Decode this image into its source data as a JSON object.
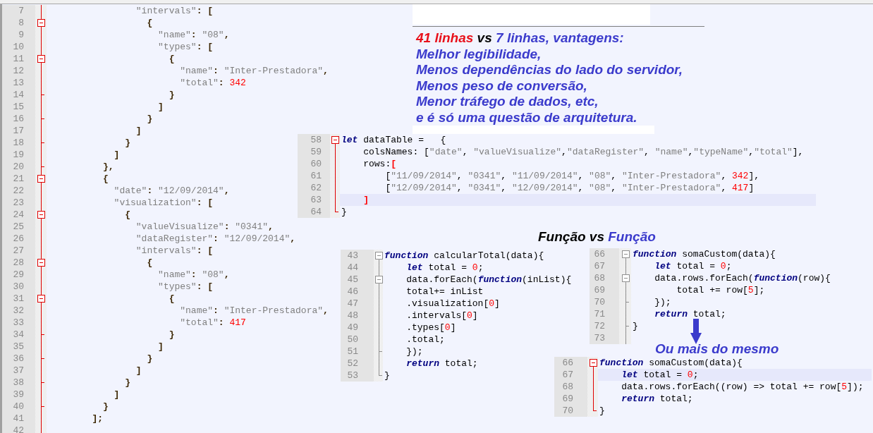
{
  "main_editor": {
    "fold_active": true,
    "lines": [
      {
        "number": "7",
        "kind": "line",
        "tokens": [
          {
            "kind": "string",
            "text": "                \"intervals\""
          },
          {
            "kind": "punct",
            "text": ": ["
          }
        ]
      },
      {
        "number": "8",
        "kind": "open",
        "tokens": [
          {
            "kind": "punct",
            "text": "                  {"
          }
        ]
      },
      {
        "number": "9",
        "kind": "line",
        "tokens": [
          {
            "kind": "string",
            "text": "                    \"name\""
          },
          {
            "kind": "punct",
            "text": ": "
          },
          {
            "kind": "string",
            "text": "\"08\""
          },
          {
            "kind": "punct",
            "text": ","
          }
        ]
      },
      {
        "number": "10",
        "kind": "line",
        "tokens": [
          {
            "kind": "string",
            "text": "                    \"types\""
          },
          {
            "kind": "punct",
            "text": ": ["
          }
        ]
      },
      {
        "number": "11",
        "kind": "open",
        "tokens": [
          {
            "kind": "punct",
            "text": "                      {"
          }
        ]
      },
      {
        "number": "12",
        "kind": "line",
        "tokens": [
          {
            "kind": "string",
            "text": "                        \"name\""
          },
          {
            "kind": "punct",
            "text": ": "
          },
          {
            "kind": "string",
            "text": "\"Inter-Prestadora\""
          },
          {
            "kind": "punct",
            "text": ","
          }
        ]
      },
      {
        "number": "13",
        "kind": "line",
        "tokens": [
          {
            "kind": "string",
            "text": "                        \"total\""
          },
          {
            "kind": "punct",
            "text": ": "
          },
          {
            "kind": "number",
            "text": "342"
          }
        ]
      },
      {
        "number": "14",
        "kind": "end",
        "tokens": [
          {
            "kind": "punct",
            "text": "                      }"
          }
        ]
      },
      {
        "number": "15",
        "kind": "line",
        "tokens": [
          {
            "kind": "punct",
            "text": "                    ]"
          }
        ]
      },
      {
        "number": "16",
        "kind": "end",
        "tokens": [
          {
            "kind": "punct",
            "text": "                  }"
          }
        ]
      },
      {
        "number": "17",
        "kind": "line",
        "tokens": [
          {
            "kind": "punct",
            "text": "                ]"
          }
        ]
      },
      {
        "number": "18",
        "kind": "end",
        "tokens": [
          {
            "kind": "punct",
            "text": "              }"
          }
        ]
      },
      {
        "number": "19",
        "kind": "line",
        "tokens": [
          {
            "kind": "punct",
            "text": "            ]"
          }
        ]
      },
      {
        "number": "20",
        "kind": "end",
        "tokens": [
          {
            "kind": "punct",
            "text": "          },"
          }
        ]
      },
      {
        "number": "21",
        "kind": "open",
        "tokens": [
          {
            "kind": "punct",
            "text": "          {"
          }
        ]
      },
      {
        "number": "22",
        "kind": "line",
        "tokens": [
          {
            "kind": "string",
            "text": "            \"date\""
          },
          {
            "kind": "punct",
            "text": ": "
          },
          {
            "kind": "string",
            "text": "\"12/09/2014\""
          },
          {
            "kind": "punct",
            "text": ","
          }
        ]
      },
      {
        "number": "23",
        "kind": "line",
        "tokens": [
          {
            "kind": "string",
            "text": "            \"visualization\""
          },
          {
            "kind": "punct",
            "text": ": ["
          }
        ]
      },
      {
        "number": "24",
        "kind": "open",
        "tokens": [
          {
            "kind": "punct",
            "text": "              {"
          }
        ]
      },
      {
        "number": "25",
        "kind": "line",
        "tokens": [
          {
            "kind": "string",
            "text": "                \"valueVisualize\""
          },
          {
            "kind": "punct",
            "text": ": "
          },
          {
            "kind": "string",
            "text": "\"0341\""
          },
          {
            "kind": "punct",
            "text": ","
          }
        ]
      },
      {
        "number": "26",
        "kind": "line",
        "tokens": [
          {
            "kind": "string",
            "text": "                \"dataRegister\""
          },
          {
            "kind": "punct",
            "text": ": "
          },
          {
            "kind": "string",
            "text": "\"12/09/2014\""
          },
          {
            "kind": "punct",
            "text": ","
          }
        ]
      },
      {
        "number": "27",
        "kind": "line",
        "tokens": [
          {
            "kind": "string",
            "text": "                \"intervals\""
          },
          {
            "kind": "punct",
            "text": ": ["
          }
        ]
      },
      {
        "number": "28",
        "kind": "open",
        "tokens": [
          {
            "kind": "punct",
            "text": "                  {"
          }
        ]
      },
      {
        "number": "29",
        "kind": "line",
        "tokens": [
          {
            "kind": "string",
            "text": "                    \"name\""
          },
          {
            "kind": "punct",
            "text": ": "
          },
          {
            "kind": "string",
            "text": "\"08\""
          },
          {
            "kind": "punct",
            "text": ","
          }
        ]
      },
      {
        "number": "30",
        "kind": "line",
        "tokens": [
          {
            "kind": "string",
            "text": "                    \"types\""
          },
          {
            "kind": "punct",
            "text": ": ["
          }
        ]
      },
      {
        "number": "31",
        "kind": "open",
        "tokens": [
          {
            "kind": "punct",
            "text": "                      {"
          }
        ]
      },
      {
        "number": "32",
        "kind": "line",
        "tokens": [
          {
            "kind": "string",
            "text": "                        \"name\""
          },
          {
            "kind": "punct",
            "text": ": "
          },
          {
            "kind": "string",
            "text": "\"Inter-Prestadora\""
          },
          {
            "kind": "punct",
            "text": ","
          }
        ]
      },
      {
        "number": "33",
        "kind": "line",
        "tokens": [
          {
            "kind": "string",
            "text": "                        \"total\""
          },
          {
            "kind": "punct",
            "text": ": "
          },
          {
            "kind": "number",
            "text": "417"
          }
        ]
      },
      {
        "number": "34",
        "kind": "end",
        "tokens": [
          {
            "kind": "punct",
            "text": "                      }"
          }
        ]
      },
      {
        "number": "35",
        "kind": "line",
        "tokens": [
          {
            "kind": "punct",
            "text": "                    ]"
          }
        ]
      },
      {
        "number": "36",
        "kind": "end",
        "tokens": [
          {
            "kind": "punct",
            "text": "                  }"
          }
        ]
      },
      {
        "number": "37",
        "kind": "line",
        "tokens": [
          {
            "kind": "punct",
            "text": "                ]"
          }
        ]
      },
      {
        "number": "38",
        "kind": "end",
        "tokens": [
          {
            "kind": "punct",
            "text": "              }"
          }
        ]
      },
      {
        "number": "39",
        "kind": "line",
        "tokens": [
          {
            "kind": "punct",
            "text": "            ]"
          }
        ]
      },
      {
        "number": "40",
        "kind": "end",
        "tokens": [
          {
            "kind": "punct",
            "text": "          }"
          }
        ]
      },
      {
        "number": "41",
        "kind": "line",
        "tokens": [
          {
            "kind": "punct",
            "text": "        ];"
          }
        ]
      },
      {
        "number": "42",
        "kind": "line"
      }
    ]
  },
  "notes": {
    "lines": [
      {
        "segments": [
          {
            "text": "41 linhas",
            "color": "#e8101a"
          },
          {
            "text": " vs ",
            "color": "#000000"
          },
          {
            "text": "7 linhas, vantagens:",
            "color": "#3b3bcc"
          }
        ]
      },
      {
        "segments": [
          {
            "text": "Melhor legibilidade,",
            "color": "#3b3bcc"
          }
        ]
      },
      {
        "segments": [
          {
            "text": "Menos dependências do lado do servidor,",
            "color": "#3b3bcc"
          }
        ]
      },
      {
        "segments": [
          {
            "text": "Menos peso de conversão,",
            "color": "#3b3bcc"
          }
        ]
      },
      {
        "segments": [
          {
            "text": "Menor tráfego de dados, etc,",
            "color": "#3b3bcc"
          }
        ]
      },
      {
        "segments": [
          {
            "text": "e é só uma questão de arquitetura.",
            "color": "#3b3bcc"
          }
        ]
      }
    ]
  },
  "snippets": [
    {
      "fold_active": true,
      "lines": [
        {
          "number": "58",
          "kind": "open",
          "highlighted": false,
          "tokens": [
            {
              "kind": "keyword",
              "text": "let"
            },
            {
              "kind": "plain",
              "text": " dataTable =   {"
            }
          ]
        },
        {
          "number": "59",
          "kind": "line",
          "highlighted": false,
          "tokens": [
            {
              "kind": "plain",
              "text": "    colsNames: ["
            },
            {
              "kind": "string",
              "text": "\"date\""
            },
            {
              "kind": "plain",
              "text": ", "
            },
            {
              "kind": "string",
              "text": "\"valueVisualize\""
            },
            {
              "kind": "plain",
              "text": ","
            },
            {
              "kind": "string",
              "text": "\"dataRegister\""
            },
            {
              "kind": "plain",
              "text": ", "
            },
            {
              "kind": "string",
              "text": "\"name\""
            },
            {
              "kind": "plain",
              "text": ","
            },
            {
              "kind": "string",
              "text": "\"typeName\""
            },
            {
              "kind": "plain",
              "text": ","
            },
            {
              "kind": "string",
              "text": "\"total\""
            },
            {
              "kind": "plain",
              "text": "],"
            }
          ]
        },
        {
          "number": "60",
          "kind": "line",
          "highlighted": false,
          "tokens": [
            {
              "kind": "plain",
              "text": "    rows:"
            },
            {
              "kind": "match",
              "text": "["
            }
          ]
        },
        {
          "number": "61",
          "kind": "line",
          "highlighted": false,
          "tokens": [
            {
              "kind": "plain",
              "text": "        ["
            },
            {
              "kind": "string",
              "text": "\"11/09/2014\""
            },
            {
              "kind": "plain",
              "text": ", "
            },
            {
              "kind": "string",
              "text": "\"0341\""
            },
            {
              "kind": "plain",
              "text": ", "
            },
            {
              "kind": "string",
              "text": "\"11/09/2014\""
            },
            {
              "kind": "plain",
              "text": ", "
            },
            {
              "kind": "string",
              "text": "\"08\""
            },
            {
              "kind": "plain",
              "text": ", "
            },
            {
              "kind": "string",
              "text": "\"Inter-Prestadora\""
            },
            {
              "kind": "plain",
              "text": ", "
            },
            {
              "kind": "number",
              "text": "342"
            },
            {
              "kind": "plain",
              "text": "],"
            }
          ]
        },
        {
          "number": "62",
          "kind": "line",
          "highlighted": false,
          "tokens": [
            {
              "kind": "plain",
              "text": "        ["
            },
            {
              "kind": "string",
              "text": "\"12/09/2014\""
            },
            {
              "kind": "plain",
              "text": ", "
            },
            {
              "kind": "string",
              "text": "\"0341\""
            },
            {
              "kind": "plain",
              "text": ", "
            },
            {
              "kind": "string",
              "text": "\"12/09/2014\""
            },
            {
              "kind": "plain",
              "text": ", "
            },
            {
              "kind": "string",
              "text": "\"08\""
            },
            {
              "kind": "plain",
              "text": ", "
            },
            {
              "kind": "string",
              "text": "\"Inter-Prestadora\""
            },
            {
              "kind": "plain",
              "text": ", "
            },
            {
              "kind": "number",
              "text": "417"
            },
            {
              "kind": "plain",
              "text": "]"
            }
          ]
        },
        {
          "number": "63",
          "kind": "line",
          "highlighted": true,
          "tokens": [
            {
              "kind": "match",
              "text": "    ]"
            }
          ]
        },
        {
          "number": "64",
          "kind": "end",
          "highlighted": false,
          "tokens": [
            {
              "kind": "plain",
              "text": "}"
            }
          ]
        }
      ]
    },
    {
      "fold_active": false,
      "lines": [
        {
          "number": "43",
          "kind": "open",
          "tokens": [
            {
              "kind": "keyword",
              "text": "function"
            },
            {
              "kind": "plain",
              "text": " calcularTotal(data){"
            }
          ]
        },
        {
          "number": "44",
          "kind": "line",
          "tokens": [
            {
              "kind": "keyword",
              "text": "    let"
            },
            {
              "kind": "plain",
              "text": " total = "
            },
            {
              "kind": "number",
              "text": "0"
            },
            {
              "kind": "plain",
              "text": ";"
            }
          ]
        },
        {
          "number": "45",
          "kind": "open",
          "tokens": [
            {
              "kind": "plain",
              "text": "    data.forEach("
            },
            {
              "kind": "keyword",
              "text": "function"
            },
            {
              "kind": "plain",
              "text": "(inList){"
            }
          ]
        },
        {
          "number": "46",
          "kind": "line",
          "tokens": [
            {
              "kind": "plain",
              "text": "    total+= inList"
            }
          ]
        },
        {
          "number": "47",
          "kind": "line",
          "tokens": [
            {
              "kind": "plain",
              "text": "    .visualization["
            },
            {
              "kind": "number",
              "text": "0"
            },
            {
              "kind": "plain",
              "text": "]"
            }
          ]
        },
        {
          "number": "48",
          "kind": "line",
          "tokens": [
            {
              "kind": "plain",
              "text": "    .intervals["
            },
            {
              "kind": "number",
              "text": "0"
            },
            {
              "kind": "plain",
              "text": "]"
            }
          ]
        },
        {
          "number": "49",
          "kind": "line",
          "tokens": [
            {
              "kind": "plain",
              "text": "    .types["
            },
            {
              "kind": "number",
              "text": "0"
            },
            {
              "kind": "plain",
              "text": "]"
            }
          ]
        },
        {
          "number": "50",
          "kind": "line",
          "tokens": [
            {
              "kind": "plain",
              "text": "    .total;"
            }
          ]
        },
        {
          "number": "51",
          "kind": "end",
          "tokens": [
            {
              "kind": "plain",
              "text": "    });"
            }
          ]
        },
        {
          "number": "52",
          "kind": "line",
          "tokens": [
            {
              "kind": "keyword",
              "text": "    return"
            },
            {
              "kind": "plain",
              "text": " total;"
            }
          ]
        },
        {
          "number": "53",
          "kind": "end",
          "tokens": [
            {
              "kind": "plain",
              "text": "}"
            }
          ]
        }
      ]
    },
    {
      "fold_active": false,
      "lines": [
        {
          "number": "66",
          "kind": "open",
          "tokens": [
            {
              "kind": "keyword",
              "text": "function"
            },
            {
              "kind": "plain",
              "text": " somaCustom(data){"
            }
          ]
        },
        {
          "number": "67",
          "kind": "line",
          "tokens": [
            {
              "kind": "keyword",
              "text": "    let"
            },
            {
              "kind": "plain",
              "text": " total = "
            },
            {
              "kind": "number",
              "text": "0"
            },
            {
              "kind": "plain",
              "text": ";"
            }
          ]
        },
        {
          "number": "68",
          "kind": "open",
          "tokens": [
            {
              "kind": "plain",
              "text": "    data.rows.forEach("
            },
            {
              "kind": "keyword",
              "text": "function"
            },
            {
              "kind": "plain",
              "text": "(row){"
            }
          ]
        },
        {
          "number": "69",
          "kind": "line",
          "tokens": [
            {
              "kind": "plain",
              "text": "        total += row["
            },
            {
              "kind": "number",
              "text": "5"
            },
            {
              "kind": "plain",
              "text": "];"
            }
          ]
        },
        {
          "number": "70",
          "kind": "end",
          "tokens": [
            {
              "kind": "plain",
              "text": "    });"
            }
          ]
        },
        {
          "number": "71",
          "kind": "line",
          "tokens": [
            {
              "kind": "keyword",
              "text": "    return"
            },
            {
              "kind": "plain",
              "text": " total;"
            }
          ]
        },
        {
          "number": "72",
          "kind": "end",
          "tokens": [
            {
              "kind": "plain",
              "text": "}"
            }
          ]
        },
        {
          "number": "73",
          "kind": "line"
        }
      ]
    },
    {
      "fold_active": true,
      "lines": [
        {
          "number": "66",
          "kind": "open",
          "highlighted": false,
          "tokens": [
            {
              "kind": "keyword",
              "text": "function"
            },
            {
              "kind": "plain",
              "text": " somaCustom(data){"
            }
          ]
        },
        {
          "number": "67",
          "kind": "line",
          "highlighted": true,
          "tokens": [
            {
              "kind": "keyword",
              "text": "    let"
            },
            {
              "kind": "plain",
              "text": " total = "
            },
            {
              "kind": "number",
              "text": "0"
            },
            {
              "kind": "plain",
              "text": ";"
            }
          ]
        },
        {
          "number": "68",
          "kind": "line",
          "highlighted": false,
          "tokens": [
            {
              "kind": "plain",
              "text": "    data.rows.forEach((row) => total += row["
            },
            {
              "kind": "number",
              "text": "5"
            },
            {
              "kind": "plain",
              "text": "]);"
            }
          ]
        },
        {
          "number": "69",
          "kind": "line",
          "highlighted": false,
          "tokens": [
            {
              "kind": "keyword",
              "text": "    return"
            },
            {
              "kind": "plain",
              "text": " total;"
            }
          ]
        },
        {
          "number": "70",
          "kind": "end",
          "highlighted": false,
          "tokens": [
            {
              "kind": "plain",
              "text": "}"
            }
          ]
        }
      ]
    }
  ],
  "comparison_title": {
    "segments": [
      {
        "text": "Função vs ",
        "color": "#000000"
      },
      {
        "text": "Função",
        "color": "#3b3bcc"
      }
    ]
  },
  "caption": "Ou mais do mesmo"
}
